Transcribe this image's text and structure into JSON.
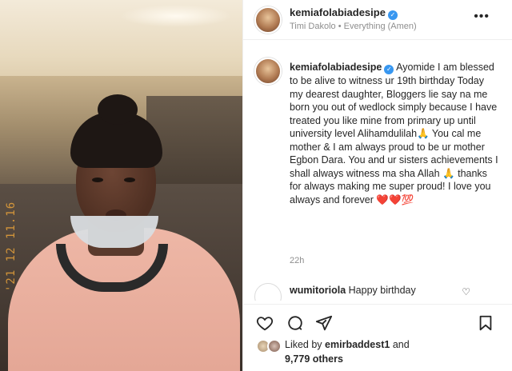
{
  "colors": {
    "verified_badge": "#3897f0",
    "text_primary": "#262626",
    "text_secondary": "#8e8e8e",
    "divider": "#efefef",
    "date_stamp": "#e8a23a"
  },
  "media": {
    "date_stamp": "'21 12 11.16"
  },
  "header": {
    "username": "kemiafolabiadesipe",
    "verified_icon": "verified-badge-icon",
    "subtitle": "Timi Dakolo • Everything (Amen)",
    "more_icon": "more-options-icon"
  },
  "caption": {
    "username": "kemiafolabiadesipe",
    "text": "Ayomide I am blessed to be alive to witness ur 19th birthday Today my dearest daughter, Bloggers lie say na me born you out of wedlock simply because I have treated you like mine from primary up until university level Alihamdulilah🙏 You cal me mother & I am always proud to be ur mother Egbon Dara. You and ur sisters achievements I shall always witness ma sha Allah 🙏 thanks for always making me super proud! I love you always and forever ❤️❤️💯",
    "time": "22h"
  },
  "comment": {
    "username": "wumitoriola",
    "text": "Happy birthday",
    "like_icon": "heart-outline-icon"
  },
  "actions": {
    "like_icon": "heart-icon",
    "comment_icon": "comment-icon",
    "share_icon": "share-icon",
    "save_icon": "bookmark-icon"
  },
  "likes": {
    "liked_by_prefix": "Liked by",
    "liked_by_user": "emirbaddest1",
    "and": "and",
    "others_count": "9,779 others"
  }
}
